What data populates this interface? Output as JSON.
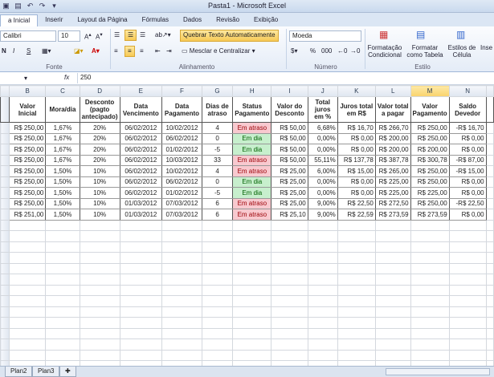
{
  "window": {
    "title": "Pasta1 - Microsoft Excel"
  },
  "tabs": [
    {
      "label": "a Inicial",
      "active": true
    },
    {
      "label": "Inserir"
    },
    {
      "label": "Layout da Página"
    },
    {
      "label": "Fórmulas"
    },
    {
      "label": "Dados"
    },
    {
      "label": "Revisão"
    },
    {
      "label": "Exibição"
    }
  ],
  "ribbon": {
    "font_name": "Calibri",
    "font_size": "10",
    "wrap_text": "Quebrar Texto Automaticamente",
    "merge_center": "Mesclar e Centralizar",
    "number_format": "Moeda",
    "percent": "%",
    "thousands": "000",
    "cond_format": "Formatação Condicional",
    "format_table": "Formatar como Tabela",
    "cell_styles": "Estilos de Célula",
    "insert": "Inse",
    "groups": {
      "font": "Fonte",
      "alignment": "Alinhamento",
      "number": "Número",
      "style": "Estilo"
    }
  },
  "formula_bar": {
    "fx": "fx",
    "value": "250"
  },
  "columns": [
    "B",
    "C",
    "D",
    "E",
    "F",
    "G",
    "H",
    "I",
    "J",
    "K",
    "L",
    "M",
    "N"
  ],
  "selected_column": "M",
  "headers": [
    "Valor Inicial",
    "Mora/dia",
    "Desconto (pagto antecipado)",
    "Data Vencimento",
    "Data Pagamento",
    "Dias de atraso",
    "Status Pagamento",
    "Valor do Desconto",
    "Total juros em %",
    "Juros total em R$",
    "Valor total a pagar",
    "Valor Pagamento",
    "Saldo Devedor"
  ],
  "rows": [
    [
      "R$ 250,00",
      "1,67%",
      "20%",
      "06/02/2012",
      "10/02/2012",
      "4",
      "Em atraso",
      "R$ 50,00",
      "6,68%",
      "R$ 16,70",
      "R$ 266,70",
      "R$ 250,00",
      "-R$ 16,70"
    ],
    [
      "R$ 250,00",
      "1,67%",
      "20%",
      "06/02/2012",
      "06/02/2012",
      "0",
      "Em dia",
      "R$ 50,00",
      "0,00%",
      "R$ 0,00",
      "R$ 200,00",
      "R$ 250,00",
      "R$ 0,00"
    ],
    [
      "R$ 250,00",
      "1,67%",
      "20%",
      "06/02/2012",
      "01/02/2012",
      "-5",
      "Em dia",
      "R$ 50,00",
      "0,00%",
      "R$ 0,00",
      "R$ 200,00",
      "R$ 200,00",
      "R$ 0,00"
    ],
    [
      "R$ 250,00",
      "1,67%",
      "20%",
      "06/02/2012",
      "10/03/2012",
      "33",
      "Em atraso",
      "R$ 50,00",
      "55,11%",
      "R$ 137,78",
      "R$ 387,78",
      "R$ 300,78",
      "-R$ 87,00"
    ],
    [
      "R$ 250,00",
      "1,50%",
      "10%",
      "06/02/2012",
      "10/02/2012",
      "4",
      "Em atraso",
      "R$ 25,00",
      "6,00%",
      "R$ 15,00",
      "R$ 265,00",
      "R$ 250,00",
      "-R$ 15,00"
    ],
    [
      "R$ 250,00",
      "1,50%",
      "10%",
      "06/02/2012",
      "06/02/2012",
      "0",
      "Em dia",
      "R$ 25,00",
      "0,00%",
      "R$ 0,00",
      "R$ 225,00",
      "R$ 250,00",
      "R$ 0,00"
    ],
    [
      "R$ 250,00",
      "1,50%",
      "10%",
      "06/02/2012",
      "01/02/2012",
      "-5",
      "Em dia",
      "R$ 25,00",
      "0,00%",
      "R$ 0,00",
      "R$ 225,00",
      "R$ 225,00",
      "R$ 0,00"
    ],
    [
      "R$ 250,00",
      "1,50%",
      "10%",
      "01/03/2012",
      "07/03/2012",
      "6",
      "Em atraso",
      "R$ 25,00",
      "9,00%",
      "R$ 22,50",
      "R$ 272,50",
      "R$ 250,00",
      "-R$ 22,50"
    ],
    [
      "R$ 251,00",
      "1,50%",
      "10%",
      "01/03/2012",
      "07/03/2012",
      "6",
      "Em atraso",
      "R$ 25,10",
      "9,00%",
      "R$ 22,59",
      "R$ 273,59",
      "R$ 273,59",
      "R$ 0,00"
    ]
  ],
  "sheets": [
    "Plan2",
    "Plan3"
  ],
  "colors": {
    "late_bg": "#f8c9cf",
    "ok_bg": "#c7efcd",
    "selected_header": "#f9d36b"
  }
}
